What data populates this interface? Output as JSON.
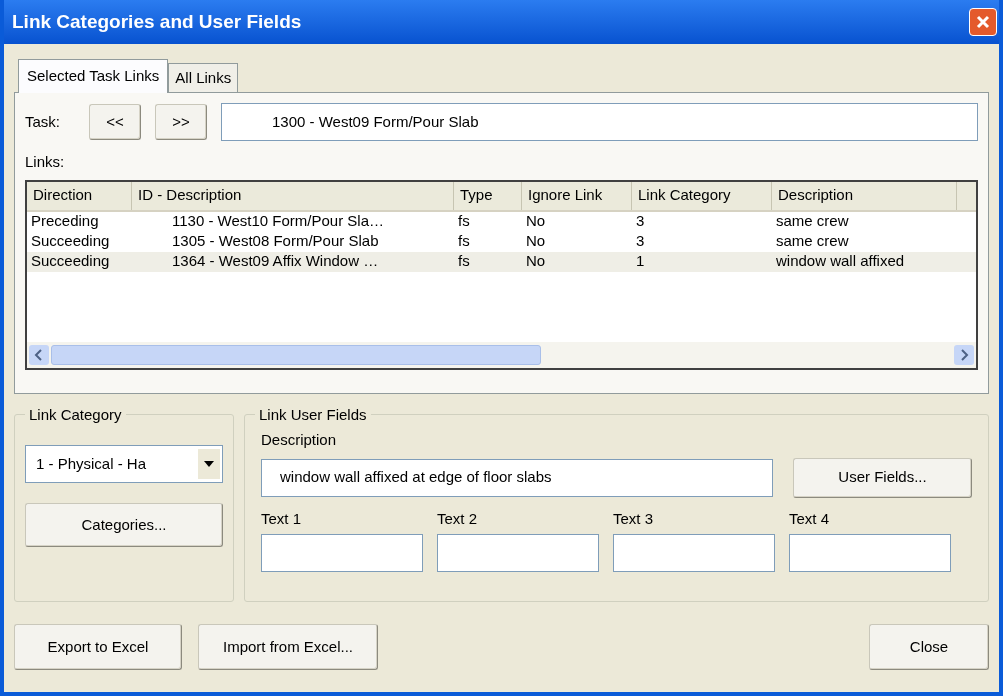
{
  "window": {
    "title": "Link Categories and User Fields"
  },
  "tabs": [
    {
      "label": "Selected Task Links",
      "selected": true
    },
    {
      "label": "All Links",
      "selected": false
    }
  ],
  "task": {
    "label": "Task:",
    "prev": "<<",
    "next": ">>",
    "value": "1300 - West09 Form/Pour Slab"
  },
  "links": {
    "label": "Links:",
    "columns": [
      "Direction",
      "ID - Description",
      "Type",
      "Ignore Link",
      "Link Category",
      "Description"
    ],
    "rows": [
      {
        "cells": [
          "Preceding",
          "1130 - West10 Form/Pour Sla…",
          "fs",
          "No",
          "3",
          "same crew"
        ],
        "selected": false
      },
      {
        "cells": [
          "Succeeding",
          "1305 - West08 Form/Pour Slab",
          "fs",
          "No",
          "3",
          "same crew"
        ],
        "selected": false
      },
      {
        "cells": [
          "Succeeding",
          "1364 - West09 Affix Window …",
          "fs",
          "No",
          "1",
          "window wall affixed"
        ],
        "selected": true
      }
    ]
  },
  "link_category": {
    "title": "Link Category",
    "value": "1 - Physical - Ha",
    "button": "Categories..."
  },
  "link_user_fields": {
    "title": "Link User Fields",
    "description_label": "Description",
    "description_value": "window wall affixed at edge of floor slabs",
    "button": "User Fields...",
    "texts": [
      {
        "label": "Text 1"
      },
      {
        "label": "Text 2"
      },
      {
        "label": "Text 3"
      },
      {
        "label": "Text 4"
      }
    ]
  },
  "buttons": {
    "export": "Export to Excel",
    "import": "Import from Excel...",
    "close": "Close"
  }
}
